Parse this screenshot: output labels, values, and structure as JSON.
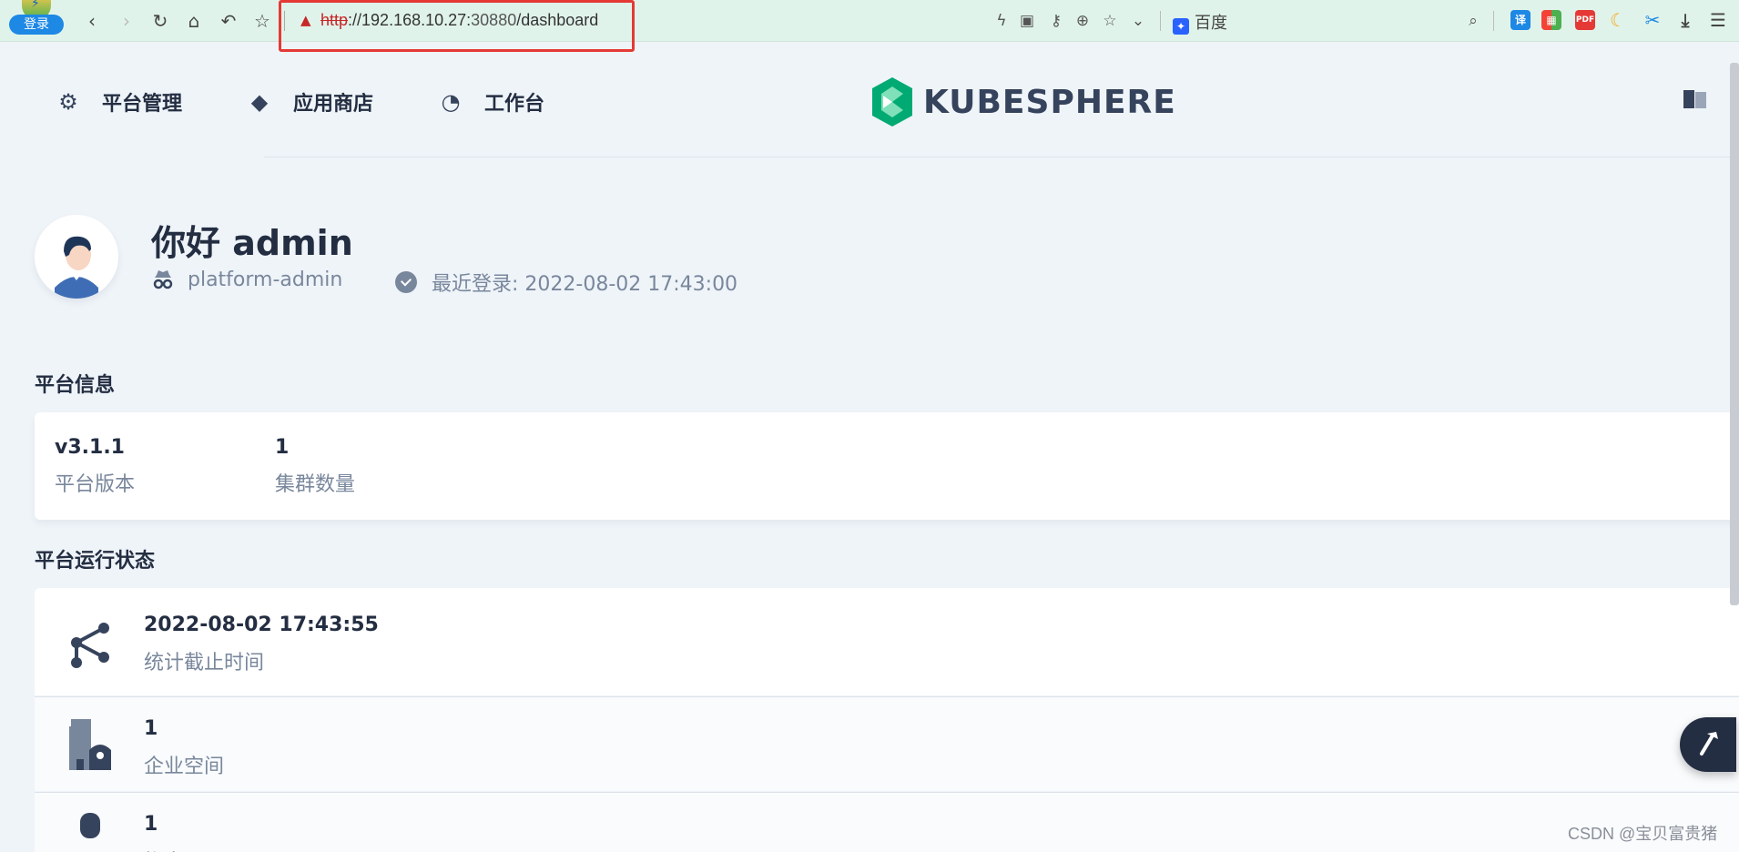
{
  "browser": {
    "login_badge": "登录",
    "url_protocol": "http",
    "url_host": "://192.168.10.27:",
    "url_port": "30880",
    "url_path": "/dashboard",
    "search_engine": "百度"
  },
  "header": {
    "nav": [
      {
        "label": "平台管理",
        "icon": "gear-icon"
      },
      {
        "label": "应用商店",
        "icon": "layers-icon"
      },
      {
        "label": "工作台",
        "icon": "dashboard-icon"
      }
    ],
    "brand": "KUBESPHERE",
    "brand_color": "#00aa72"
  },
  "welcome": {
    "greeting": "你好 admin",
    "role": "platform-admin",
    "last_login": "最近登录: 2022-08-02 17:43:00"
  },
  "platform_info": {
    "title": "平台信息",
    "items": [
      {
        "value": "v3.1.1",
        "label": "平台版本"
      },
      {
        "value": "1",
        "label": "集群数量"
      }
    ]
  },
  "platform_status": {
    "title": "平台运行状态",
    "rows": [
      {
        "value": "2022-08-02 17:43:55",
        "label": "统计截止时间",
        "icon": "share-icon"
      },
      {
        "value": "1",
        "label": "企业空间",
        "icon": "building-icon"
      },
      {
        "value": "1",
        "label": "帐户",
        "icon": "user-icon"
      }
    ]
  },
  "watermark": "CSDN @宝贝富贵猪"
}
